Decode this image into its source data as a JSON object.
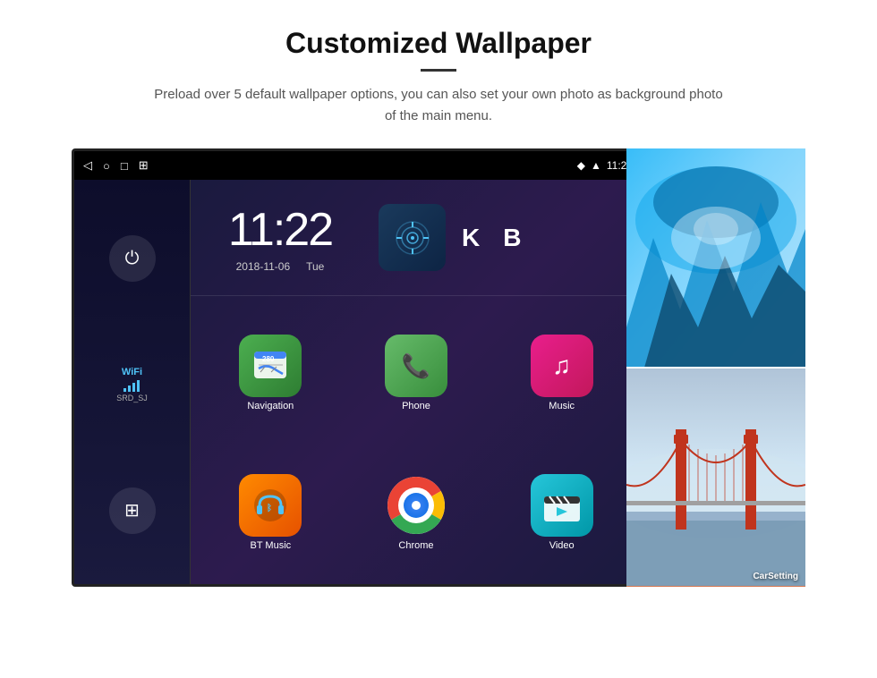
{
  "header": {
    "title": "Customized Wallpaper",
    "subtitle": "Preload over 5 default wallpaper options, you can also set your own photo as background photo of the main menu."
  },
  "statusBar": {
    "time": "11:22",
    "icons": [
      "back-icon",
      "home-icon",
      "recents-icon",
      "screenshot-icon",
      "location-icon",
      "wifi-icon"
    ]
  },
  "clock": {
    "time": "11:22",
    "date": "2018-11-06",
    "day": "Tue"
  },
  "wifi": {
    "label": "WiFi",
    "ssid": "SRD_SJ"
  },
  "apps": [
    {
      "name": "Navigation",
      "icon": "map-icon"
    },
    {
      "name": "Phone",
      "icon": "phone-icon"
    },
    {
      "name": "Music",
      "icon": "music-icon"
    },
    {
      "name": "BT Music",
      "icon": "bluetooth-icon"
    },
    {
      "name": "Chrome",
      "icon": "chrome-icon"
    },
    {
      "name": "Video",
      "icon": "video-icon"
    }
  ],
  "wallpapers": [
    {
      "label": ""
    },
    {
      "label": "CarSetting"
    }
  ],
  "sidebarButtons": [
    {
      "name": "power-button",
      "icon": "⏻"
    },
    {
      "name": "apps-button",
      "icon": "⊞"
    }
  ]
}
